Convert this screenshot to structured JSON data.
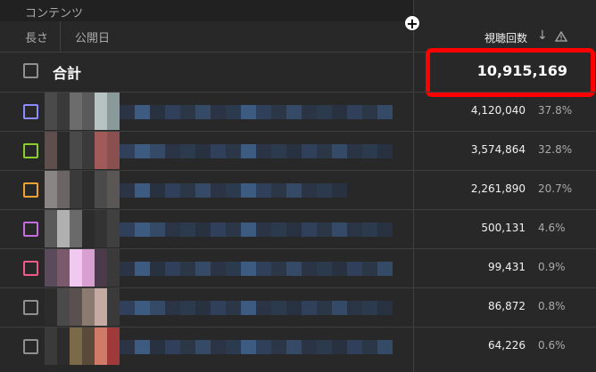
{
  "header": {
    "content_label": "コンテンツ",
    "filters": [
      "長さ",
      "公開日"
    ],
    "metric": "視聴回数"
  },
  "total": {
    "label": "合計",
    "views": "10,915,169"
  },
  "rows": [
    {
      "views": "4,120,040",
      "pct": "37.8%",
      "color": "#8c8cff"
    },
    {
      "views": "3,574,864",
      "pct": "32.8%",
      "color": "#8ccf2c"
    },
    {
      "views": "2,261,890",
      "pct": "20.7%",
      "color": "#f0a233"
    },
    {
      "views": "500,131",
      "pct": "4.6%",
      "color": "#c26ee0"
    },
    {
      "views": "99,431",
      "pct": "0.9%",
      "color": "#ef5a88"
    },
    {
      "views": "86,872",
      "pct": "0.8%",
      "color": "#909090"
    },
    {
      "views": "64,226",
      "pct": "0.6%",
      "color": "#909090"
    }
  ]
}
